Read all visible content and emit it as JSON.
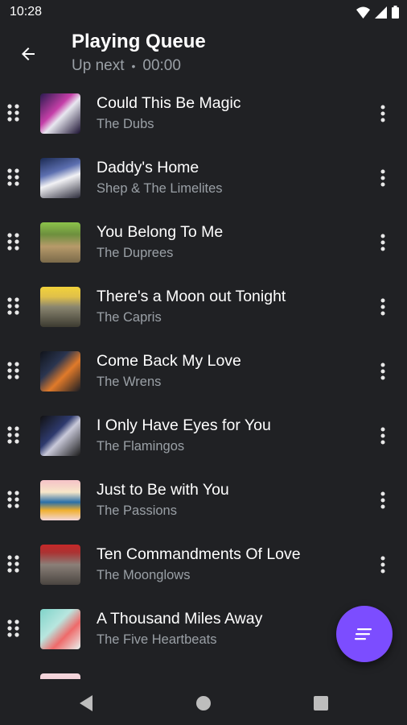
{
  "status_bar": {
    "time": "10:28"
  },
  "header": {
    "title": "Playing Queue",
    "subtitle_label": "Up next",
    "subtitle_separator": "•",
    "duration": "00:00"
  },
  "queue": [
    {
      "title": "Could This Be Magic",
      "artist": "The Dubs"
    },
    {
      "title": "Daddy's Home",
      "artist": "Shep & The Limelites"
    },
    {
      "title": "You Belong To Me",
      "artist": "The Duprees"
    },
    {
      "title": "There's a Moon out Tonight",
      "artist": "The Capris"
    },
    {
      "title": "Come Back My Love",
      "artist": "The Wrens"
    },
    {
      "title": "I Only Have Eyes for You",
      "artist": "The Flamingos"
    },
    {
      "title": "Just to Be with You",
      "artist": "The Passions"
    },
    {
      "title": "Ten Commandments Of Love",
      "artist": "The Moonglows"
    },
    {
      "title": "A Thousand Miles Away",
      "artist": "The Five Heartbeats"
    }
  ],
  "colors": {
    "background": "#202124",
    "accent": "#7c4dff",
    "secondary_text": "#9aa0a6"
  },
  "icons": {
    "back": "arrow-back-icon",
    "drag": "drag-handle-icon",
    "more": "more-vert-icon",
    "fab": "queue-list-icon",
    "nav_back": "triangle-back-icon",
    "nav_home": "circle-home-icon",
    "nav_recents": "square-recents-icon"
  }
}
